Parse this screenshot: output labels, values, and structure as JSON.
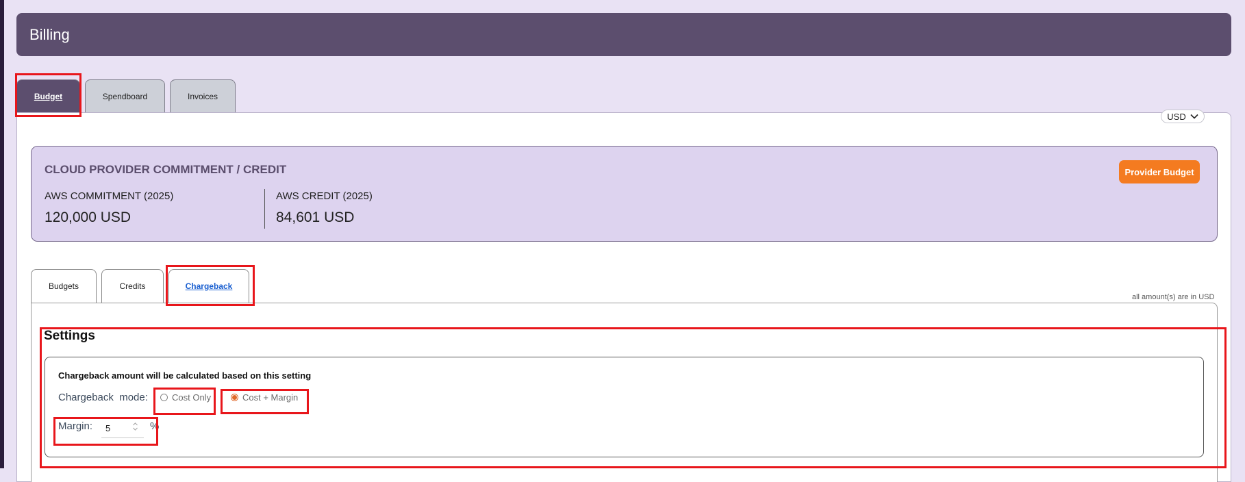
{
  "header": {
    "title": "Billing"
  },
  "tabs": [
    {
      "label": "Budget",
      "active": true
    },
    {
      "label": "Spendboard",
      "active": false
    },
    {
      "label": "Invoices",
      "active": false
    }
  ],
  "currency": {
    "selected": "USD"
  },
  "commitment_card": {
    "title": "CLOUD PROVIDER COMMITMENT / CREDIT",
    "items": [
      {
        "label": "AWS COMMITMENT (2025)",
        "value": "120,000  USD"
      },
      {
        "label": "AWS CREDIT (2025)",
        "value": "84,601  USD"
      }
    ],
    "button_label": "Provider Budget"
  },
  "subtabs": [
    {
      "label": "Budgets",
      "active": false
    },
    {
      "label": "Credits",
      "active": false
    },
    {
      "label": "Chargeback",
      "active": true
    }
  ],
  "amount_note": "all amount(s) are in USD",
  "settings": {
    "title": "Settings",
    "description": "Chargeback amount will be calculated based on this setting",
    "mode_label": "Chargeback  mode:",
    "options": [
      {
        "label": "Cost Only",
        "checked": false
      },
      {
        "label": "Cost + Margin",
        "checked": true
      }
    ],
    "margin_label": "Margin:",
    "margin_value": "5",
    "margin_unit": "%"
  },
  "colors": {
    "header_bg": "#5c4e6e",
    "page_bg": "#e9e2f4",
    "card_bg": "#ddd3ef",
    "accent_orange": "#f47b20",
    "active_link": "#1a5fd0",
    "highlight_red": "#e8161b"
  },
  "icons": {
    "currency_dropdown": "chevron-down-icon",
    "margin_spinner": "spinner-arrows-icon"
  }
}
